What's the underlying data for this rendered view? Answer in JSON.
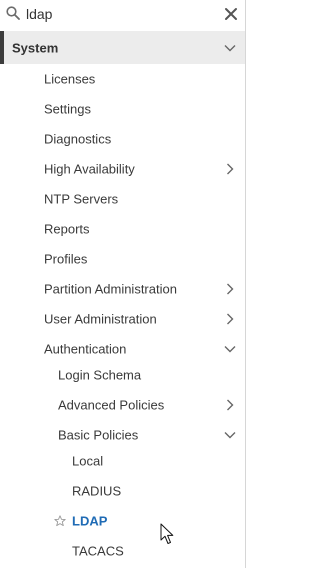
{
  "search": {
    "value": "ldap",
    "icon": "search-icon",
    "clear_icon": "close-icon"
  },
  "nav": {
    "system": {
      "label": "System",
      "expanded": true
    },
    "items": [
      {
        "label": "Licenses"
      },
      {
        "label": "Settings"
      },
      {
        "label": "Diagnostics"
      },
      {
        "label": "High Availability",
        "has_children": true
      },
      {
        "label": "NTP Servers"
      },
      {
        "label": "Reports"
      },
      {
        "label": "Profiles"
      },
      {
        "label": "Partition Administration",
        "has_children": true
      },
      {
        "label": "User Administration",
        "has_children": true
      },
      {
        "label": "Authentication",
        "expanded": true
      }
    ],
    "authentication_children": [
      {
        "label": "Login Schema"
      },
      {
        "label": "Advanced Policies",
        "has_children": true
      },
      {
        "label": "Basic Policies",
        "expanded": true
      }
    ],
    "basic_policies_children": [
      {
        "label": "Local"
      },
      {
        "label": "RADIUS"
      },
      {
        "label": "LDAP",
        "active": true,
        "favorite_icon": "star-outline-icon"
      },
      {
        "label": "TACACS"
      }
    ]
  },
  "colors": {
    "active_text": "#1f6bb5",
    "selected_row_bg": "#ececec",
    "accent_bar": "#3c3c3c"
  }
}
